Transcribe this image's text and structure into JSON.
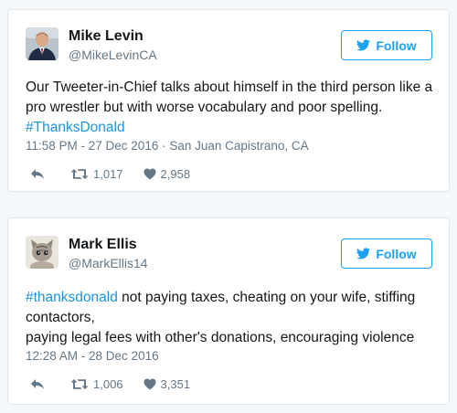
{
  "tweets": [
    {
      "name": "Mike Levin",
      "handle": "@MikeLevinCA",
      "follow_label": "Follow",
      "text_before": "Our Tweeter-in-Chief talks about himself in the third person like a pro wrestler but with worse vocabulary and poor spelling. ",
      "hashtag": "#ThanksDonald",
      "text_after": "",
      "meta": "11:58 PM - 27 Dec 2016 · San Juan Capistrano, CA",
      "retweets": "1,017",
      "likes": "2,958"
    },
    {
      "name": "Mark Ellis",
      "handle": "@MarkEllis14",
      "follow_label": "Follow",
      "hashtag": "#thanksdonald",
      "line1_rest": " not paying taxes, cheating on your wife, stiffing contactors,",
      "line2": "paying legal fees with other's donations, encouraging violence",
      "meta": "12:28 AM - 28 Dec 2016",
      "retweets": "1,006",
      "likes": "3,351"
    }
  ],
  "colors": {
    "accent": "#1da1f2",
    "hashtag": "#1b95e0",
    "muted": "#657786",
    "border": "#e1e8ed"
  },
  "icons": [
    "twitter-bird-icon",
    "reply-icon",
    "retweet-icon",
    "heart-icon"
  ]
}
